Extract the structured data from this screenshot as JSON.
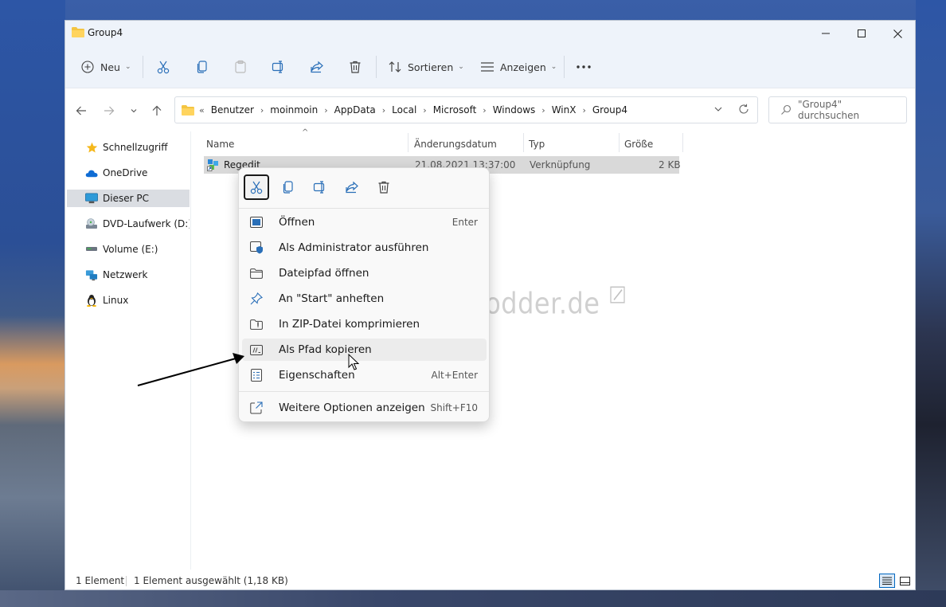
{
  "window": {
    "title": "Group4"
  },
  "toolbar": {
    "new_label": "Neu",
    "sort_label": "Sortieren",
    "view_label": "Anzeigen"
  },
  "address": {
    "overflow": "«",
    "crumbs": [
      "Benutzer",
      "moinmoin",
      "AppData",
      "Local",
      "Microsoft",
      "Windows",
      "WinX",
      "Group4"
    ]
  },
  "search": {
    "placeholder": "\"Group4\" durchsuchen"
  },
  "sidebar": {
    "items": [
      {
        "label": "Schnellzugriff",
        "icon": "star-icon"
      },
      {
        "label": "OneDrive",
        "icon": "cloud-icon"
      },
      {
        "label": "Dieser PC",
        "icon": "pc-icon"
      },
      {
        "label": "DVD-Laufwerk (D:) C",
        "icon": "dvd-drive-icon"
      },
      {
        "label": "Volume (E:)",
        "icon": "drive-icon"
      },
      {
        "label": "Netzwerk",
        "icon": "network-icon"
      },
      {
        "label": "Linux",
        "icon": "linux-icon"
      }
    ]
  },
  "columns": {
    "name": "Name",
    "date": "Änderungsdatum",
    "type": "Typ",
    "size": "Größe"
  },
  "files": [
    {
      "name": "Regedit",
      "date": "21.08.2021 13:37:00",
      "type": "Verknüpfung",
      "size": "2 KB"
    }
  ],
  "context_menu": {
    "items": [
      {
        "label": "Öffnen",
        "shortcut": "Enter"
      },
      {
        "label": "Als Administrator ausführen",
        "shortcut": ""
      },
      {
        "label": "Dateipfad öffnen",
        "shortcut": ""
      },
      {
        "label": "An \"Start\" anheften",
        "shortcut": ""
      },
      {
        "label": "In ZIP-Datei komprimieren",
        "shortcut": ""
      },
      {
        "label": "Als Pfad kopieren",
        "shortcut": ""
      },
      {
        "label": "Eigenschaften",
        "shortcut": "Alt+Enter"
      },
      {
        "label": "Weitere Optionen anzeigen",
        "shortcut": "Shift+F10"
      }
    ]
  },
  "status": {
    "count": "1 Element",
    "selected": "1 Element ausgewählt (1,18 KB)"
  },
  "watermark": "Deskmodder.de",
  "colors": {
    "accent": "#0067c0",
    "folder": "#f4c542",
    "selection": "#d9d9d9"
  }
}
